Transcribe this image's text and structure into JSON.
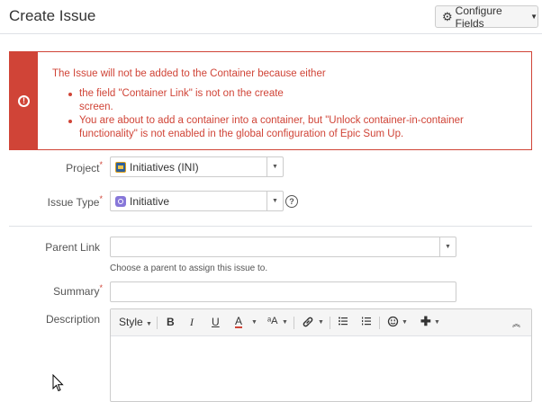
{
  "header": {
    "title": "Create Issue",
    "configure_label": "Configure Fields"
  },
  "error": {
    "heading": "The Issue will not be added to the Container because either",
    "items": [
      "the field \"Container Link\" is not on the create screen.",
      "You are about to add a container into a container, but \"Unlock container-in-container functionality\" is not enabled in the global configuration of Epic Sum Up."
    ]
  },
  "fields": {
    "project": {
      "label": "Project",
      "value": "Initiatives (INI)"
    },
    "issue_type": {
      "label": "Issue Type",
      "value": "Initiative"
    },
    "parent_link": {
      "label": "Parent Link",
      "value": "",
      "hint": "Choose a parent to assign this issue to."
    },
    "summary": {
      "label": "Summary",
      "value": ""
    },
    "description": {
      "label": "Description"
    }
  },
  "toolbar": {
    "style_label": "Style",
    "bold": "B",
    "italic": "I",
    "underline": "U",
    "text_color": "A",
    "text_size": "ᵃA"
  },
  "required_marker": "*",
  "icons": {
    "config": "gear-icon",
    "error": "exclamation-circle-icon",
    "help": "question-circle-icon"
  },
  "colors": {
    "error": "#d04437",
    "initiative": "#8777d9"
  }
}
